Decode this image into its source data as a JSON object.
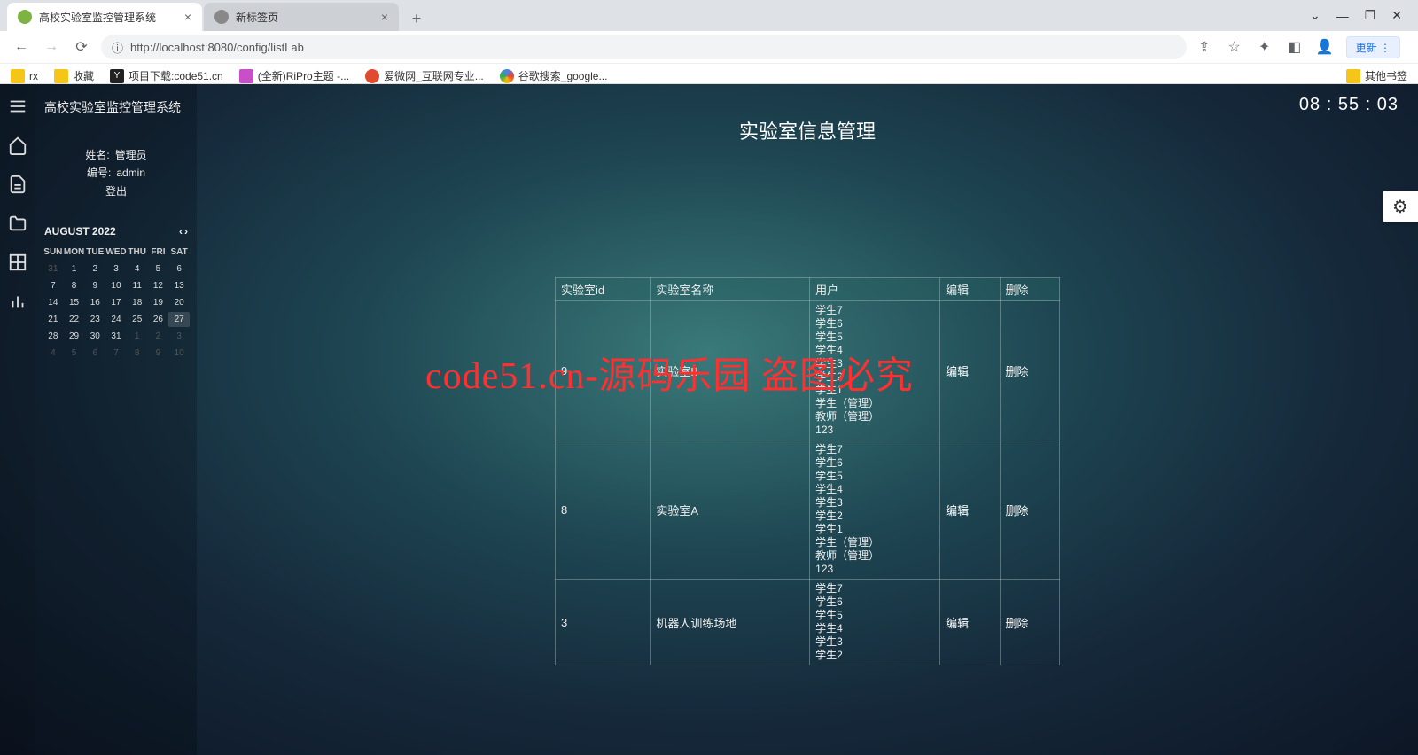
{
  "browser": {
    "tabs": [
      {
        "title": "高校实验室监控管理系统",
        "active": true
      },
      {
        "title": "新标签页",
        "active": false
      }
    ],
    "window_controls": {
      "dropdown": "⌄",
      "min": "—",
      "max": "❐",
      "close": "✕"
    },
    "url_info_icon": "ⓘ",
    "url": "http://localhost:8080/config/listLab",
    "update_label": "更新",
    "bookmarks": [
      {
        "label": "rx",
        "color": "#f5c518"
      },
      {
        "label": "收藏",
        "color": "#f5c518"
      },
      {
        "label": "项目下载:code51.cn",
        "color": "#333"
      },
      {
        "label": "(全新)RiPro主题 -...",
        "color": "#c94fc9"
      },
      {
        "label": "爱微网_互联网专业...",
        "color": "#e04a2f"
      },
      {
        "label": "谷歌搜索_google...",
        "color": "#4285f4"
      }
    ],
    "other_bookmarks": "其他书签"
  },
  "app": {
    "title": "高校实验室监控管理系统",
    "clock": "08 : 55 : 03",
    "user": {
      "name_label": "姓名:",
      "name_value": "管理员",
      "no_label": "编号:",
      "no_value": "admin",
      "logout": "登出"
    },
    "calendar": {
      "month": "AUGUST 2022",
      "dow": [
        "SUN",
        "MON",
        "TUE",
        "WED",
        "THU",
        "FRI",
        "SAT"
      ],
      "weeks": [
        [
          {
            "n": "31",
            "muted": true
          },
          {
            "n": "1"
          },
          {
            "n": "2"
          },
          {
            "n": "3"
          },
          {
            "n": "4"
          },
          {
            "n": "5"
          },
          {
            "n": "6"
          }
        ],
        [
          {
            "n": "7"
          },
          {
            "n": "8"
          },
          {
            "n": "9"
          },
          {
            "n": "10"
          },
          {
            "n": "11"
          },
          {
            "n": "12"
          },
          {
            "n": "13"
          }
        ],
        [
          {
            "n": "14"
          },
          {
            "n": "15"
          },
          {
            "n": "16"
          },
          {
            "n": "17"
          },
          {
            "n": "18"
          },
          {
            "n": "19"
          },
          {
            "n": "20"
          }
        ],
        [
          {
            "n": "21"
          },
          {
            "n": "22"
          },
          {
            "n": "23"
          },
          {
            "n": "24"
          },
          {
            "n": "25"
          },
          {
            "n": "26"
          },
          {
            "n": "27",
            "hl": true
          }
        ],
        [
          {
            "n": "28"
          },
          {
            "n": "29"
          },
          {
            "n": "30"
          },
          {
            "n": "31"
          },
          {
            "n": "1",
            "muted": true
          },
          {
            "n": "2",
            "muted": true
          },
          {
            "n": "3",
            "muted": true
          }
        ],
        [
          {
            "n": "4",
            "muted": true
          },
          {
            "n": "5",
            "muted": true
          },
          {
            "n": "6",
            "muted": true
          },
          {
            "n": "7",
            "muted": true
          },
          {
            "n": "8",
            "muted": true
          },
          {
            "n": "9",
            "muted": true
          },
          {
            "n": "10",
            "muted": true
          }
        ]
      ]
    },
    "page_title": "实验室信息管理",
    "table": {
      "headers": [
        "实验室id",
        "实验室名称",
        "用户",
        "编辑",
        "删除"
      ],
      "rows": [
        {
          "id": "9",
          "name": "实验室B",
          "users": [
            "学生7",
            "学生6",
            "学生5",
            "学生4",
            "学生3",
            "学生2",
            "学生1",
            "学生（管理）",
            "教师（管理）",
            "123"
          ],
          "edit": "编辑",
          "delete": "删除"
        },
        {
          "id": "8",
          "name": "实验室A",
          "users": [
            "学生7",
            "学生6",
            "学生5",
            "学生4",
            "学生3",
            "学生2",
            "学生1",
            "学生（管理）",
            "教师（管理）",
            "123"
          ],
          "edit": "编辑",
          "delete": "删除"
        },
        {
          "id": "3",
          "name": "机器人训练场地",
          "users": [
            "学生7",
            "学生6",
            "学生5",
            "学生4",
            "学生3",
            "学生2"
          ],
          "edit": "编辑",
          "delete": "删除"
        }
      ]
    },
    "watermark": "code51.cn-源码乐园 盗图必究"
  }
}
